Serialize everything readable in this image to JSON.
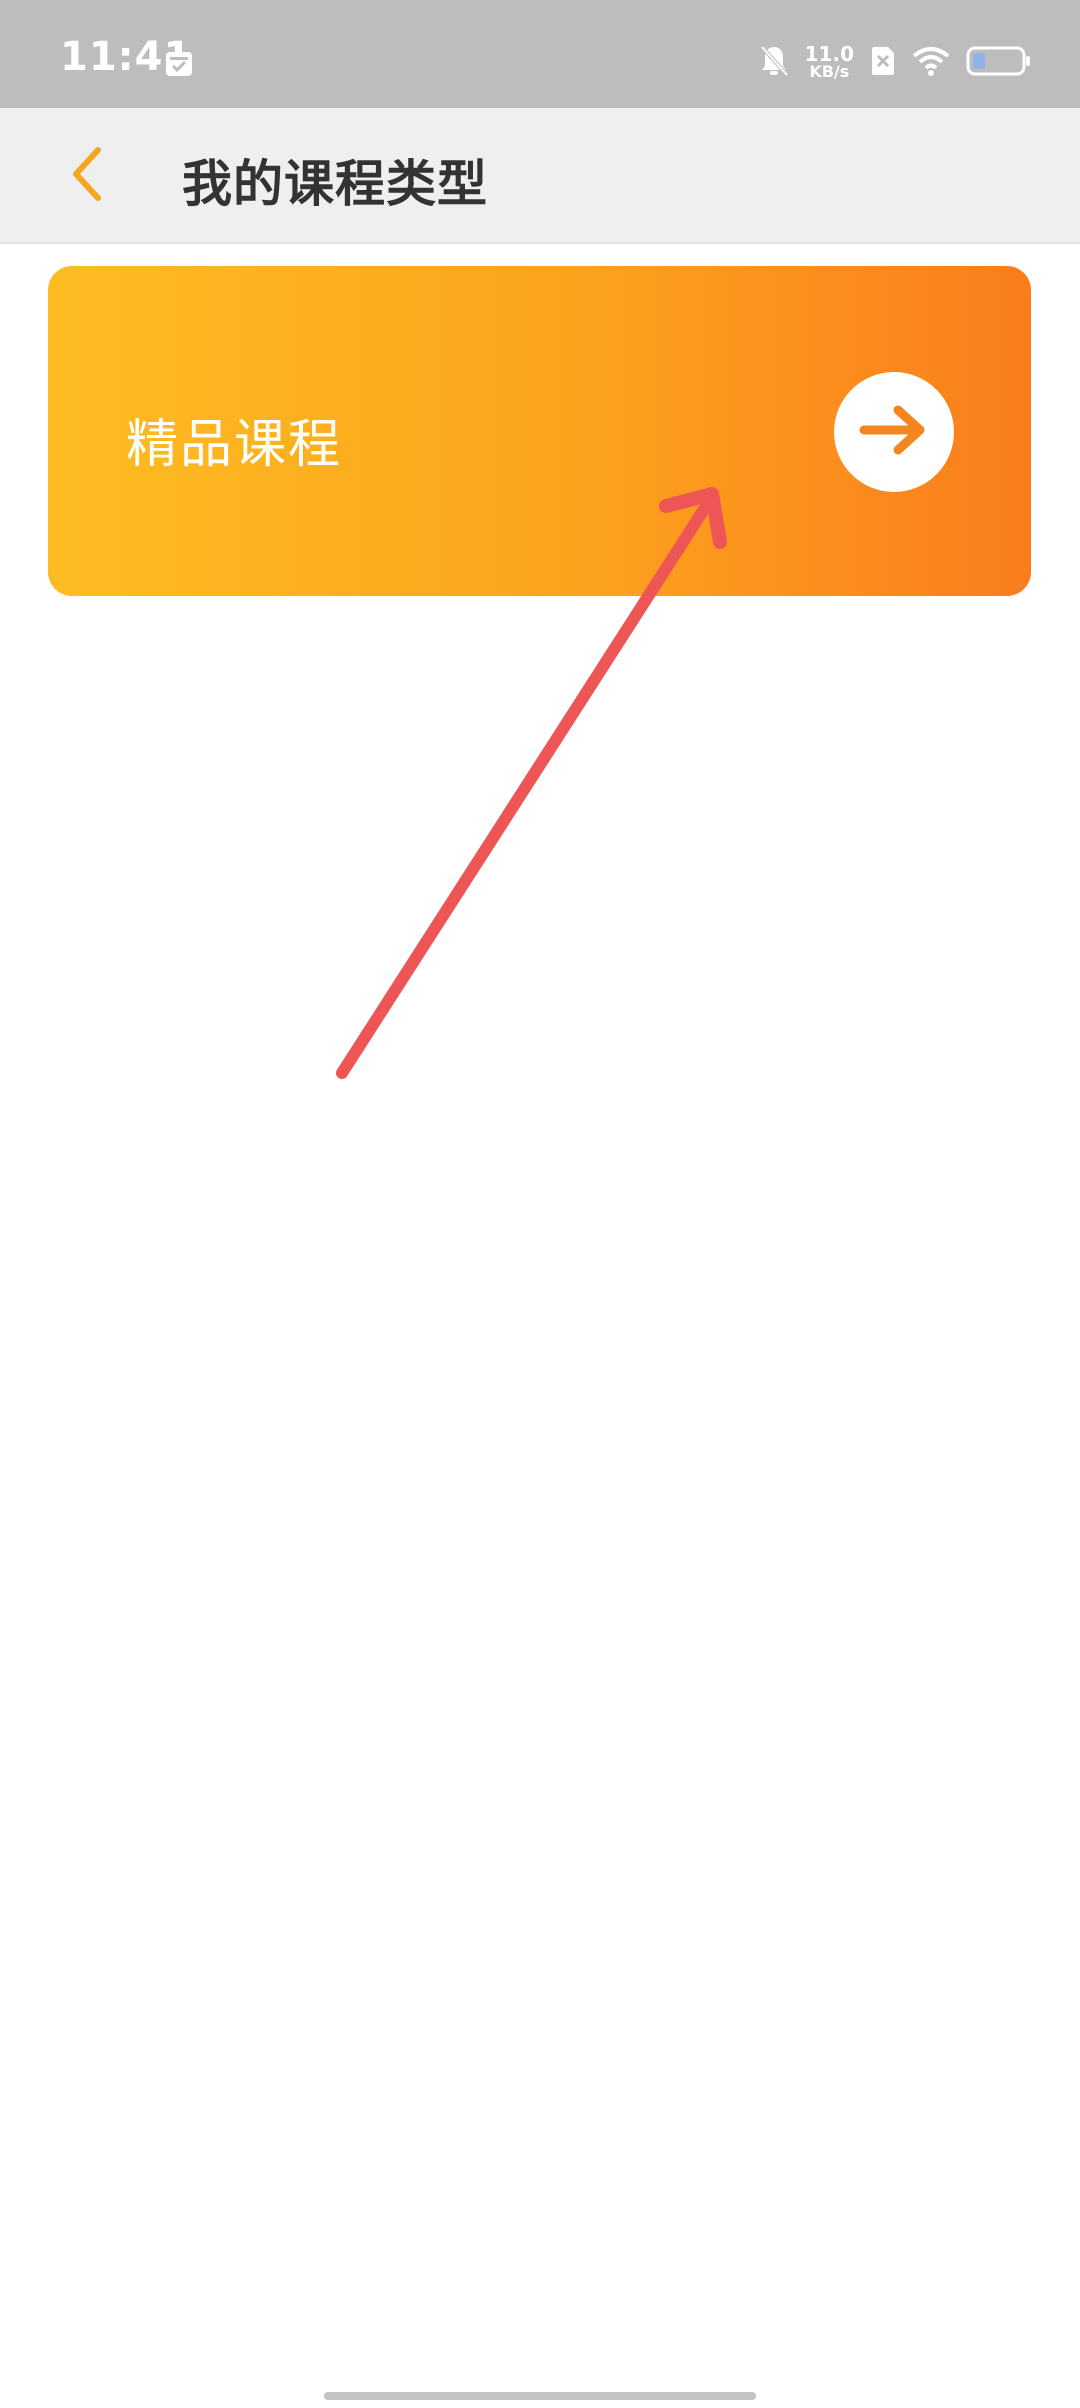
{
  "status_bar": {
    "time": "11:41",
    "net_speed_value": "11.0",
    "net_speed_unit": "KB/s",
    "icons": [
      "calendar-icon",
      "bell-muted-icon",
      "sim-disabled-icon",
      "wifi-icon",
      "battery-icon"
    ]
  },
  "header": {
    "title": "我的课程类型",
    "back_icon": "chevron-left-icon"
  },
  "course_types": [
    {
      "label": "精品课程",
      "action_icon": "arrow-right-icon"
    }
  ],
  "colors": {
    "status_bar_bg": "#bdbdbd",
    "header_bg": "#efefef",
    "accent": "#f5a623",
    "card_gradient_start": "#fdbd21",
    "card_gradient_end": "#fa7d1c",
    "annotation_arrow": "#ee5555"
  }
}
